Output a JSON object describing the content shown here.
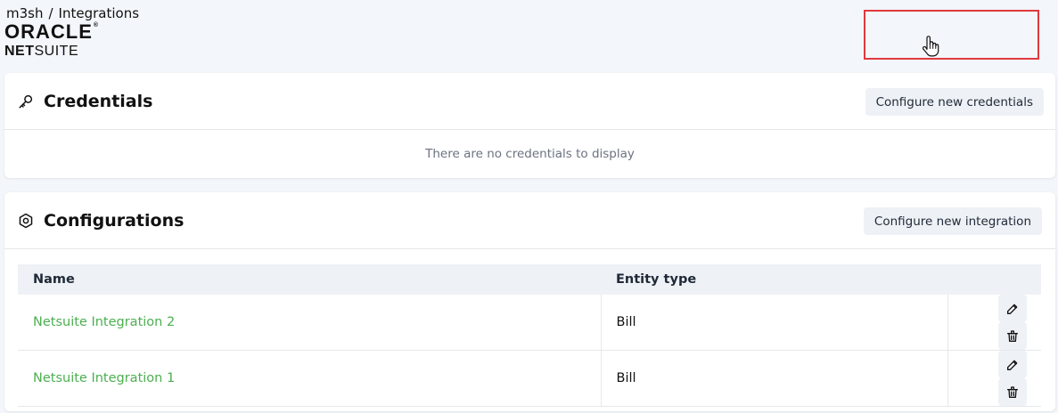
{
  "breadcrumb": {
    "org": "m3sh",
    "separator": "/",
    "page": "Integrations"
  },
  "logo": {
    "line1": "ORACLE",
    "line1_mark": "®",
    "line2_bold": "NET",
    "line2_rest": "SUITE"
  },
  "credentials": {
    "icon": "key-icon",
    "title": "Credentials",
    "button_label": "Configure new credentials",
    "empty_text": "There are no credentials to display"
  },
  "configurations": {
    "icon": "hexagon-nut-icon",
    "title": "Configurations",
    "button_label": "Configure new integration",
    "columns": [
      "Name",
      "Entity type"
    ],
    "rows": [
      {
        "name": "Netsuite Integration 2",
        "entity_type": "Bill"
      },
      {
        "name": "Netsuite Integration 1",
        "entity_type": "Bill"
      }
    ]
  },
  "colors": {
    "link": "#4caf50",
    "highlight": "#e0393e",
    "button_bg": "#eef1f5"
  }
}
